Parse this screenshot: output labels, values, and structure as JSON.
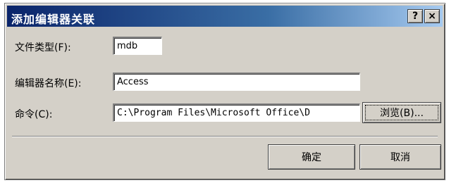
{
  "window": {
    "title": "添加编辑器关联",
    "help_glyph": "?",
    "close_glyph": "×"
  },
  "form": {
    "filetype_label": "文件类型(F):",
    "filetype_value": "mdb",
    "editor_name_label": "编辑器名称(E):",
    "editor_name_value": "Access",
    "command_label": "命令(C):",
    "command_value": "C:\\Program Files\\Microsoft Office\\D",
    "browse_label": "浏览(B)..."
  },
  "buttons": {
    "ok_label": "确定",
    "cancel_label": "取消"
  },
  "colors": {
    "title_bar_start": "#0a246a",
    "title_bar_end": "#a6caf0",
    "dialog_face": "#d4d0c8"
  }
}
